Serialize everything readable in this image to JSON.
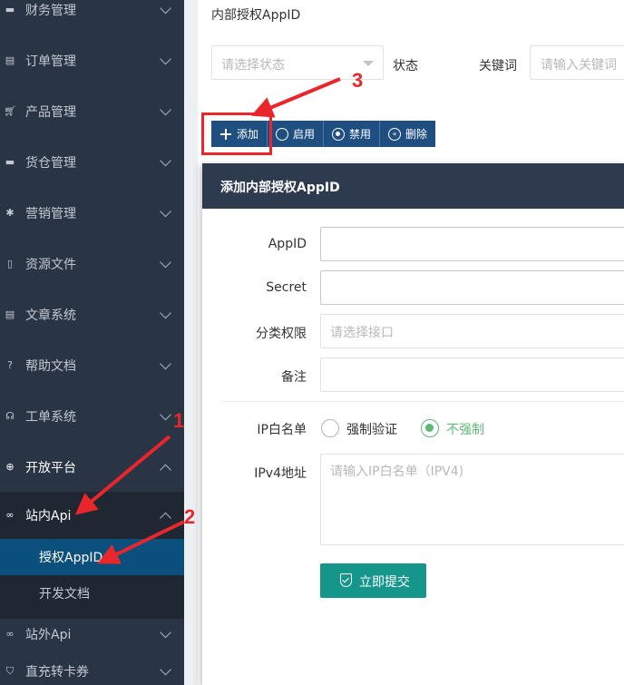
{
  "sidebar": {
    "items": [
      {
        "label": "财务管理",
        "icon": "finance-icon"
      },
      {
        "label": "订单管理",
        "icon": "order-icon"
      },
      {
        "label": "产品管理",
        "icon": "cart-icon"
      },
      {
        "label": "货仓管理",
        "icon": "warehouse-icon"
      },
      {
        "label": "营销管理",
        "icon": "marketing-icon"
      },
      {
        "label": "资源文件",
        "icon": "file-icon"
      },
      {
        "label": "文章系统",
        "icon": "article-icon"
      },
      {
        "label": "帮助文档",
        "icon": "help-icon"
      },
      {
        "label": "工单系统",
        "icon": "headset-icon"
      },
      {
        "label": "开放平台",
        "icon": "globe-icon"
      },
      {
        "label": "站内Api",
        "icon": "link-icon"
      },
      {
        "label": "站外Api",
        "icon": "link-icon"
      },
      {
        "label": "直充转卡券",
        "icon": "shield-icon"
      }
    ],
    "subitems": [
      {
        "label": "授权AppID",
        "active": true
      },
      {
        "label": "开发文档",
        "active": false
      }
    ]
  },
  "main": {
    "panel_title": "内部授权AppID",
    "filter": {
      "status_placeholder": "请选择状态",
      "status_label": "状态",
      "keyword_label": "关键词",
      "keyword_placeholder": "请输入关键词"
    },
    "toolbar": {
      "add_label": "添加",
      "enable_label": "启用",
      "disable_label": "禁用",
      "delete_label": "删除"
    }
  },
  "modal": {
    "title": "添加内部授权AppID",
    "fields": {
      "appid_label": "AppID",
      "secret_label": "Secret",
      "category_label": "分类权限",
      "category_placeholder": "请选择接口",
      "remark_label": "备注",
      "ip_whitelist_label": "IP白名单",
      "radio_force": "强制验证",
      "radio_none": "不强制",
      "ipv4_label": "IPv4地址",
      "ipv4_placeholder": "请输入IP白名单（IPV4)"
    },
    "submit_label": "立即提交"
  },
  "annotations": {
    "step1": "1",
    "step2": "2",
    "step3": "3"
  },
  "colors": {
    "sidebar_bg": "#293444",
    "sidebar_active": "#0b4f7d",
    "toolbar_btn": "#1f4f80",
    "modal_head": "#2e3b4e",
    "submit": "#16968a",
    "radio_on": "#5fb878",
    "annotation": "#e8262b"
  }
}
